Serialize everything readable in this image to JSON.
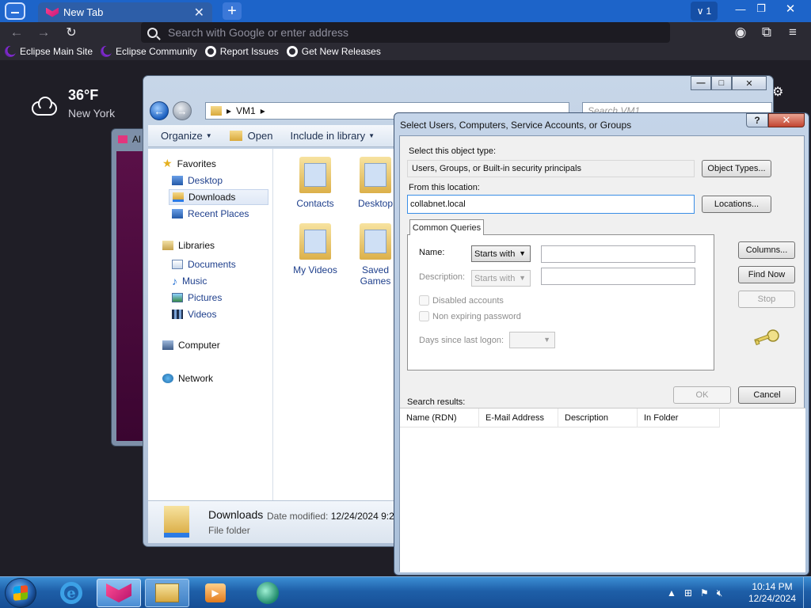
{
  "browser": {
    "tab_title": "New Tab",
    "tab_close": "✕",
    "new_tab": "+",
    "tab_count": "1",
    "url_placeholder": "Search with Google or enter address",
    "bookmarks": [
      "Eclipse Main Site",
      "Eclipse Community",
      "Report Issues",
      "Get New Releases"
    ]
  },
  "weather": {
    "temp": "36°F",
    "city": "New York"
  },
  "background_window": {
    "title_fragment": "Al"
  },
  "explorer": {
    "address_folder": "VM1",
    "search_placeholder": "Search VM1",
    "toolbar": {
      "organize": "Organize",
      "open": "Open",
      "include": "Include in library"
    },
    "nav": {
      "favorites": "Favorites",
      "desktop": "Desktop",
      "downloads": "Downloads",
      "recent": "Recent Places",
      "libraries": "Libraries",
      "documents": "Documents",
      "music": "Music",
      "pictures": "Pictures",
      "videos": "Videos",
      "computer": "Computer",
      "network": "Network"
    },
    "items": [
      "Contacts",
      "Desktop",
      "My Videos",
      "Saved Games"
    ],
    "details": {
      "name": "Downloads",
      "modified_label": "Date modified:",
      "modified_value": "12/24/2024 9:22",
      "type": "File folder"
    }
  },
  "dialog": {
    "title": "Select Users, Computers, Service Accounts, or Groups",
    "help": "?",
    "close": "✕",
    "object_type_label": "Select this object type:",
    "object_type_value": "Users, Groups, or Built-in security principals",
    "object_types_button": "Object Types...",
    "location_label": "From this location:",
    "location_value": "collabnet.local",
    "locations_button": "Locations...",
    "tab": "Common Queries",
    "name_label": "Name:",
    "name_mode": "Starts with",
    "description_label": "Description:",
    "description_mode": "Starts with",
    "disabled_accounts": "Disabled accounts",
    "non_expiring": "Non expiring password",
    "days_label": "Days since last logon:",
    "columns_button": "Columns...",
    "find_now_button": "Find Now",
    "stop_button": "Stop",
    "search_results_label": "Search results:",
    "ok_button": "OK",
    "cancel_button": "Cancel",
    "result_columns": [
      "Name (RDN)",
      "E-Mail Address",
      "Description",
      "In Folder"
    ]
  },
  "taskbar": {
    "time": "10:14 PM",
    "date": "12/24/2024"
  }
}
